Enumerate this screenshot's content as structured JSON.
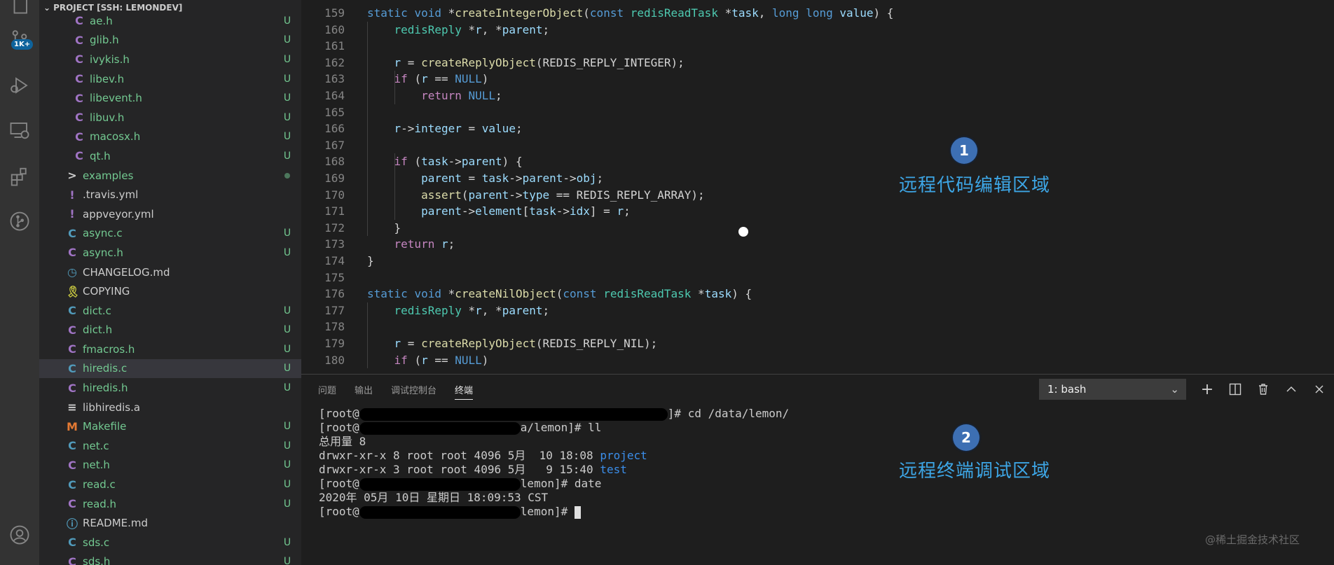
{
  "sidebar": {
    "header": "PROJECT [SSH: LEMONDEV]",
    "files": [
      {
        "name": "ae.h",
        "icon": "C",
        "icon_color": "#a074c4",
        "status": "U",
        "indent": 1
      },
      {
        "name": "glib.h",
        "icon": "C",
        "icon_color": "#a074c4",
        "status": "U",
        "indent": 1
      },
      {
        "name": "ivykis.h",
        "icon": "C",
        "icon_color": "#a074c4",
        "status": "U",
        "indent": 1
      },
      {
        "name": "libev.h",
        "icon": "C",
        "icon_color": "#a074c4",
        "status": "U",
        "indent": 1
      },
      {
        "name": "libevent.h",
        "icon": "C",
        "icon_color": "#a074c4",
        "status": "U",
        "indent": 1
      },
      {
        "name": "libuv.h",
        "icon": "C",
        "icon_color": "#a074c4",
        "status": "U",
        "indent": 1
      },
      {
        "name": "macosx.h",
        "icon": "C",
        "icon_color": "#a074c4",
        "status": "U",
        "indent": 1
      },
      {
        "name": "qt.h",
        "icon": "C",
        "icon_color": "#a074c4",
        "status": "U",
        "indent": 1
      },
      {
        "name": "examples",
        "icon": ">",
        "icon_color": "#cccccc",
        "status": "dot",
        "indent": 0
      },
      {
        "name": ".travis.yml",
        "icon": "!",
        "icon_color": "#a074c4",
        "status": "",
        "indent": 0
      },
      {
        "name": "appveyor.yml",
        "icon": "!",
        "icon_color": "#a074c4",
        "status": "",
        "indent": 0
      },
      {
        "name": "async.c",
        "icon": "C",
        "icon_color": "#519aba",
        "status": "U",
        "indent": 0
      },
      {
        "name": "async.h",
        "icon": "C",
        "icon_color": "#a074c4",
        "status": "U",
        "indent": 0
      },
      {
        "name": "CHANGELOG.md",
        "icon": "◷",
        "icon_color": "#519aba",
        "status": "",
        "indent": 0
      },
      {
        "name": "COPYING",
        "icon": "🎗",
        "icon_color": "#cbcb41",
        "status": "",
        "indent": 0
      },
      {
        "name": "dict.c",
        "icon": "C",
        "icon_color": "#519aba",
        "status": "U",
        "indent": 0
      },
      {
        "name": "dict.h",
        "icon": "C",
        "icon_color": "#a074c4",
        "status": "U",
        "indent": 0
      },
      {
        "name": "fmacros.h",
        "icon": "C",
        "icon_color": "#a074c4",
        "status": "U",
        "indent": 0
      },
      {
        "name": "hiredis.c",
        "icon": "C",
        "icon_color": "#519aba",
        "status": "U",
        "indent": 0,
        "selected": true
      },
      {
        "name": "hiredis.h",
        "icon": "C",
        "icon_color": "#a074c4",
        "status": "U",
        "indent": 0
      },
      {
        "name": "libhiredis.a",
        "icon": "≡",
        "icon_color": "#cccccc",
        "status": "",
        "indent": 0
      },
      {
        "name": "Makefile",
        "icon": "M",
        "icon_color": "#e37933",
        "status": "U",
        "indent": 0
      },
      {
        "name": "net.c",
        "icon": "C",
        "icon_color": "#519aba",
        "status": "U",
        "indent": 0
      },
      {
        "name": "net.h",
        "icon": "C",
        "icon_color": "#a074c4",
        "status": "U",
        "indent": 0
      },
      {
        "name": "read.c",
        "icon": "C",
        "icon_color": "#519aba",
        "status": "U",
        "indent": 0
      },
      {
        "name": "read.h",
        "icon": "C",
        "icon_color": "#a074c4",
        "status": "U",
        "indent": 0
      },
      {
        "name": "README.md",
        "icon": "ⓘ",
        "icon_color": "#519aba",
        "status": "",
        "indent": 0
      },
      {
        "name": "sds.c",
        "icon": "C",
        "icon_color": "#519aba",
        "status": "U",
        "indent": 0
      },
      {
        "name": "sds.h",
        "icon": "C",
        "icon_color": "#a074c4",
        "status": "U",
        "indent": 0
      }
    ]
  },
  "activity": {
    "badge": "1K+"
  },
  "editor": {
    "lines": [
      {
        "n": "159",
        "indent": 0,
        "tokens": [
          [
            "kw",
            "static "
          ],
          [
            "kw",
            "void "
          ],
          [
            "",
            "*"
          ],
          [
            "fn",
            "createIntegerObject"
          ],
          [
            "",
            "("
          ],
          [
            "kw",
            "const "
          ],
          [
            "ty",
            "redisReadTask "
          ],
          [
            "",
            "*"
          ],
          [
            "var",
            "task"
          ],
          [
            "",
            ", "
          ],
          [
            "kw",
            "long long "
          ],
          [
            "var",
            "value"
          ],
          [
            "",
            ") {"
          ]
        ]
      },
      {
        "n": "160",
        "indent": 1,
        "tokens": [
          [
            "ty",
            "redisReply "
          ],
          [
            "",
            "*"
          ],
          [
            "var",
            "r"
          ],
          [
            "",
            ", *"
          ],
          [
            "var",
            "parent"
          ],
          [
            "",
            ";"
          ]
        ]
      },
      {
        "n": "161",
        "indent": 0,
        "tokens": []
      },
      {
        "n": "162",
        "indent": 1,
        "tokens": [
          [
            "var",
            "r"
          ],
          [
            "",
            " = "
          ],
          [
            "fn",
            "createReplyObject"
          ],
          [
            "",
            "(REDIS_REPLY_INTEGER);"
          ]
        ]
      },
      {
        "n": "163",
        "indent": 1,
        "tokens": [
          [
            "ctl",
            "if "
          ],
          [
            "",
            "("
          ],
          [
            "var",
            "r"
          ],
          [
            "",
            " == "
          ],
          [
            "kw",
            "NULL"
          ],
          [
            "",
            ")"
          ]
        ]
      },
      {
        "n": "164",
        "indent": 2,
        "tokens": [
          [
            "ctl",
            "return "
          ],
          [
            "kw",
            "NULL"
          ],
          [
            "",
            ";"
          ]
        ]
      },
      {
        "n": "165",
        "indent": 0,
        "tokens": []
      },
      {
        "n": "166",
        "indent": 1,
        "tokens": [
          [
            "var",
            "r"
          ],
          [
            "",
            "->"
          ],
          [
            "var",
            "integer"
          ],
          [
            "",
            " = "
          ],
          [
            "var",
            "value"
          ],
          [
            "",
            ";"
          ]
        ]
      },
      {
        "n": "167",
        "indent": 0,
        "tokens": []
      },
      {
        "n": "168",
        "indent": 1,
        "tokens": [
          [
            "ctl",
            "if "
          ],
          [
            "",
            "("
          ],
          [
            "var",
            "task"
          ],
          [
            "",
            "->"
          ],
          [
            "var",
            "parent"
          ],
          [
            "",
            ") {"
          ]
        ]
      },
      {
        "n": "169",
        "indent": 2,
        "tokens": [
          [
            "var",
            "parent"
          ],
          [
            "",
            " = "
          ],
          [
            "var",
            "task"
          ],
          [
            "",
            "->"
          ],
          [
            "var",
            "parent"
          ],
          [
            "",
            "->"
          ],
          [
            "var",
            "obj"
          ],
          [
            "",
            ";"
          ]
        ]
      },
      {
        "n": "170",
        "indent": 2,
        "tokens": [
          [
            "fn",
            "assert"
          ],
          [
            "",
            "("
          ],
          [
            "var",
            "parent"
          ],
          [
            "",
            "->"
          ],
          [
            "var",
            "type"
          ],
          [
            "",
            " == REDIS_REPLY_ARRAY);"
          ]
        ]
      },
      {
        "n": "171",
        "indent": 2,
        "tokens": [
          [
            "var",
            "parent"
          ],
          [
            "",
            "->"
          ],
          [
            "var",
            "element"
          ],
          [
            "",
            "["
          ],
          [
            "var",
            "task"
          ],
          [
            "",
            "->"
          ],
          [
            "var",
            "idx"
          ],
          [
            "",
            "] = "
          ],
          [
            "var",
            "r"
          ],
          [
            "",
            ";"
          ]
        ]
      },
      {
        "n": "172",
        "indent": 1,
        "tokens": [
          [
            "",
            "}"
          ]
        ]
      },
      {
        "n": "173",
        "indent": 1,
        "tokens": [
          [
            "ctl",
            "return "
          ],
          [
            "var",
            "r"
          ],
          [
            "",
            ";"
          ]
        ]
      },
      {
        "n": "174",
        "indent": 0,
        "tokens": [
          [
            "",
            "}"
          ]
        ]
      },
      {
        "n": "175",
        "indent": 0,
        "tokens": []
      },
      {
        "n": "176",
        "indent": 0,
        "tokens": [
          [
            "kw",
            "static "
          ],
          [
            "kw",
            "void "
          ],
          [
            "",
            "*"
          ],
          [
            "fn",
            "createNilObject"
          ],
          [
            "",
            "("
          ],
          [
            "kw",
            "const "
          ],
          [
            "ty",
            "redisReadTask "
          ],
          [
            "",
            "*"
          ],
          [
            "var",
            "task"
          ],
          [
            "",
            ") {"
          ]
        ]
      },
      {
        "n": "177",
        "indent": 1,
        "tokens": [
          [
            "ty",
            "redisReply "
          ],
          [
            "",
            "*"
          ],
          [
            "var",
            "r"
          ],
          [
            "",
            ", *"
          ],
          [
            "var",
            "parent"
          ],
          [
            "",
            ";"
          ]
        ]
      },
      {
        "n": "178",
        "indent": 0,
        "tokens": []
      },
      {
        "n": "179",
        "indent": 1,
        "tokens": [
          [
            "var",
            "r"
          ],
          [
            "",
            " = "
          ],
          [
            "fn",
            "createReplyObject"
          ],
          [
            "",
            "(REDIS_REPLY_NIL);"
          ]
        ]
      },
      {
        "n": "180",
        "indent": 1,
        "tokens": [
          [
            "ctl",
            "if "
          ],
          [
            "",
            "("
          ],
          [
            "var",
            "r"
          ],
          [
            "",
            " == "
          ],
          [
            "kw",
            "NULL"
          ],
          [
            "",
            ")"
          ]
        ]
      }
    ],
    "annotation_1": {
      "number": "1",
      "label": "远程代码编辑区域"
    }
  },
  "panel": {
    "tabs": [
      "问题",
      "输出",
      "调试控制台",
      "终端"
    ],
    "active_tab": "终端",
    "terminal_select": "1: bash",
    "terminal_lines": [
      {
        "parts": [
          [
            "",
            "[root@"
          ],
          [
            "redact",
            ""
          ],
          [
            "",
            "]# cd /data/lemon/"
          ]
        ]
      },
      {
        "parts": [
          [
            "",
            "[root@"
          ],
          [
            "redact",
            ""
          ],
          [
            "",
            "a/lemon]# ll"
          ]
        ]
      },
      {
        "parts": [
          [
            "",
            "总用量 8"
          ]
        ]
      },
      {
        "parts": [
          [
            "",
            "drwxr-xr-x 8 root root 4096 5月  10 18:08 "
          ],
          [
            "blue",
            "project"
          ]
        ]
      },
      {
        "parts": [
          [
            "",
            "drwxr-xr-x 3 root root 4096 5月   9 15:40 "
          ],
          [
            "blue",
            "test"
          ]
        ]
      },
      {
        "parts": [
          [
            "",
            "[root@"
          ],
          [
            "redact",
            ""
          ],
          [
            "",
            "lemon]# date"
          ]
        ]
      },
      {
        "parts": [
          [
            "",
            "2020年 05月 10日 星期日 18:09:53 CST"
          ]
        ]
      },
      {
        "parts": [
          [
            "",
            "[root@"
          ],
          [
            "redact",
            ""
          ],
          [
            "",
            "lemon]# "
          ],
          [
            "cursor",
            ""
          ]
        ]
      }
    ],
    "annotation_2": {
      "number": "2",
      "label": "远程终端调试区域"
    }
  },
  "watermark": "@稀土掘金技术社区"
}
